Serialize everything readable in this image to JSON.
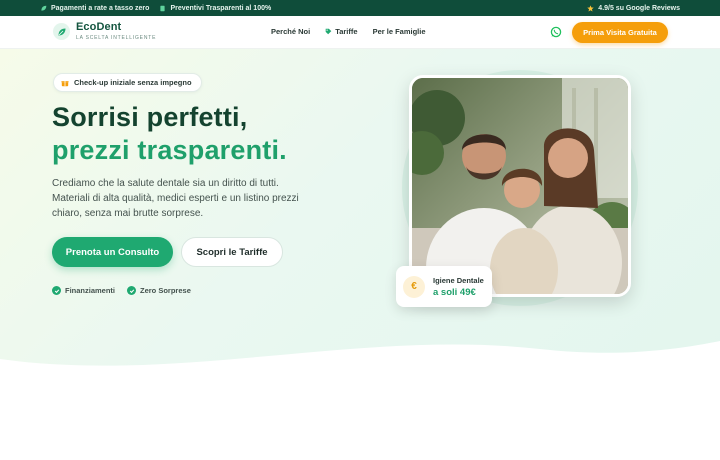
{
  "topbar": {
    "item1": "Pagamenti a rate a tasso zero",
    "item2": "Preventivi Trasparenti al 100%",
    "rating": "4.9/5 su Google Reviews"
  },
  "header": {
    "logo_name": "EcoDent",
    "logo_tagline": "LA SCELTA INTELLIGENTE",
    "nav": [
      "Perché Noi",
      "Tariffe",
      "Per le Famiglie"
    ],
    "cta": "Prima Visita  Gratuita"
  },
  "hero": {
    "badge": "Check-up iniziale senza impegno",
    "title_line1": "Sorrisi perfetti,",
    "title_line2": "prezzi trasparenti.",
    "lead": "Crediamo che la salute dentale sia un diritto di tutti. Materiali di alta qualità, medici esperti e un listino prezzi chiaro, senza mai brutte sorprese.",
    "primary_button": "Prenota un Consulto",
    "secondary_button": "Scopri le Tariffe",
    "checks": [
      "Finanziamenti",
      "Zero Sorprese"
    ],
    "price_card": {
      "title": "Igiene Dentale",
      "price": "a soli 49€",
      "icon": "€"
    }
  },
  "colors": {
    "topbar": "#0f4d3a",
    "brand_green": "#1fa971",
    "title_dark": "#14432f",
    "accent_orange": "#f59e0b"
  }
}
